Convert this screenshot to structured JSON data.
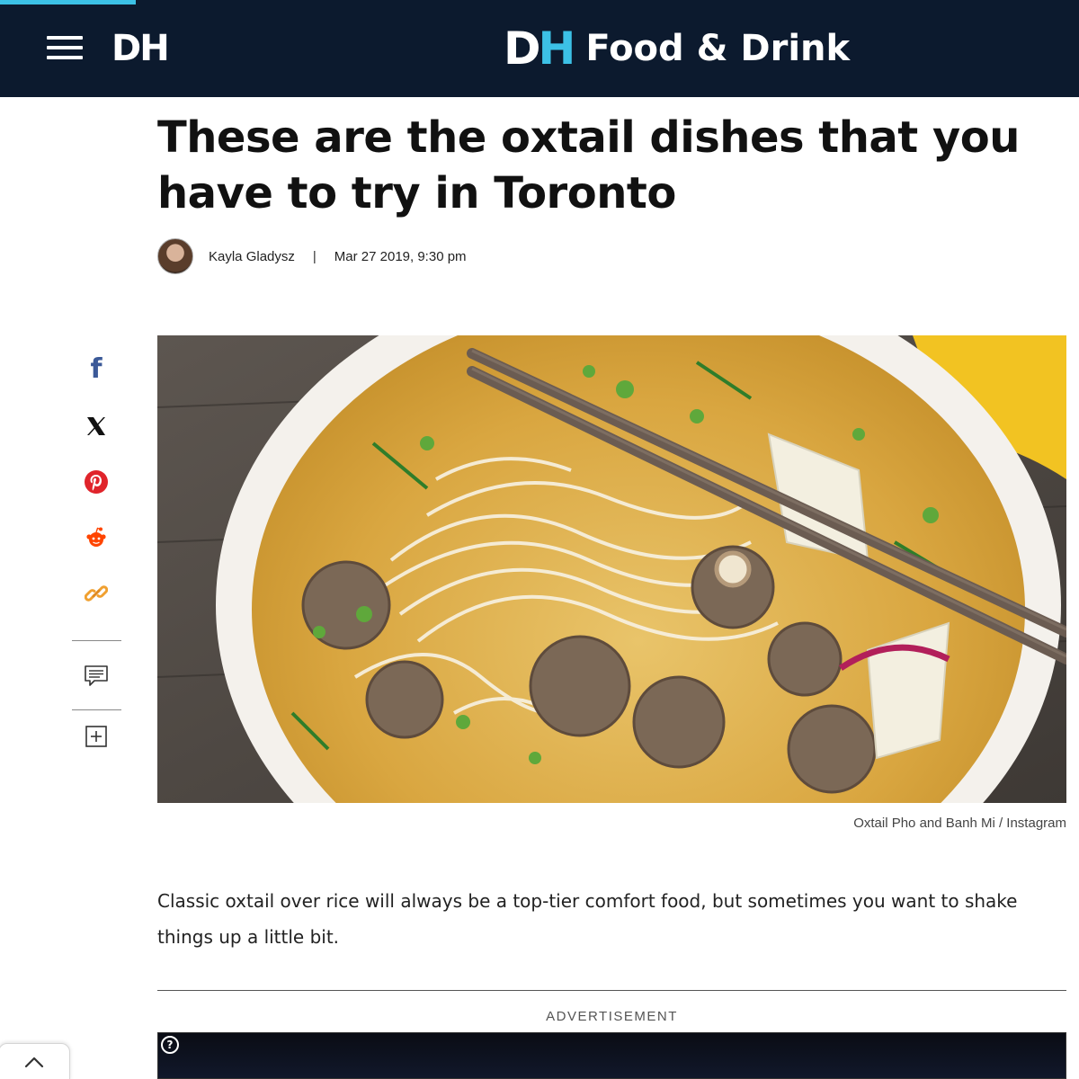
{
  "header": {
    "logo_text": "DH",
    "brand_dh_d": "D",
    "brand_dh_h": "H",
    "section_title": "Food & Drink",
    "accent_color": "#3cc1e6",
    "bar_color": "#0c1a2e",
    "menu_icon": "hamburger-menu-icon"
  },
  "article": {
    "headline": "These are the oxtail dishes that you have to try in Toronto",
    "author": "Kayla Gladysz",
    "separator": "|",
    "date": "Mar 27 2019, 9:30 pm",
    "image_caption": "Oxtail Pho and Banh Mi / Instagram",
    "body_paragraph": "Classic oxtail over rice will always be a top-tier comfort food, but sometimes you want to shake things up a little bit."
  },
  "share_rail": {
    "facebook_glyph": "f",
    "x_glyph": "X",
    "icons": [
      "facebook-icon",
      "x-icon",
      "pinterest-icon",
      "reddit-icon",
      "link-icon",
      "comment-icon",
      "add-icon"
    ],
    "colors": {
      "facebook": "#3b5998",
      "pinterest": "#e0242b",
      "reddit": "#ff4500",
      "link": "#f0a030"
    }
  },
  "ad": {
    "label": "ADVERTISEMENT",
    "help_glyph": "?"
  },
  "back_to_top_icon": "chevron-up-icon"
}
